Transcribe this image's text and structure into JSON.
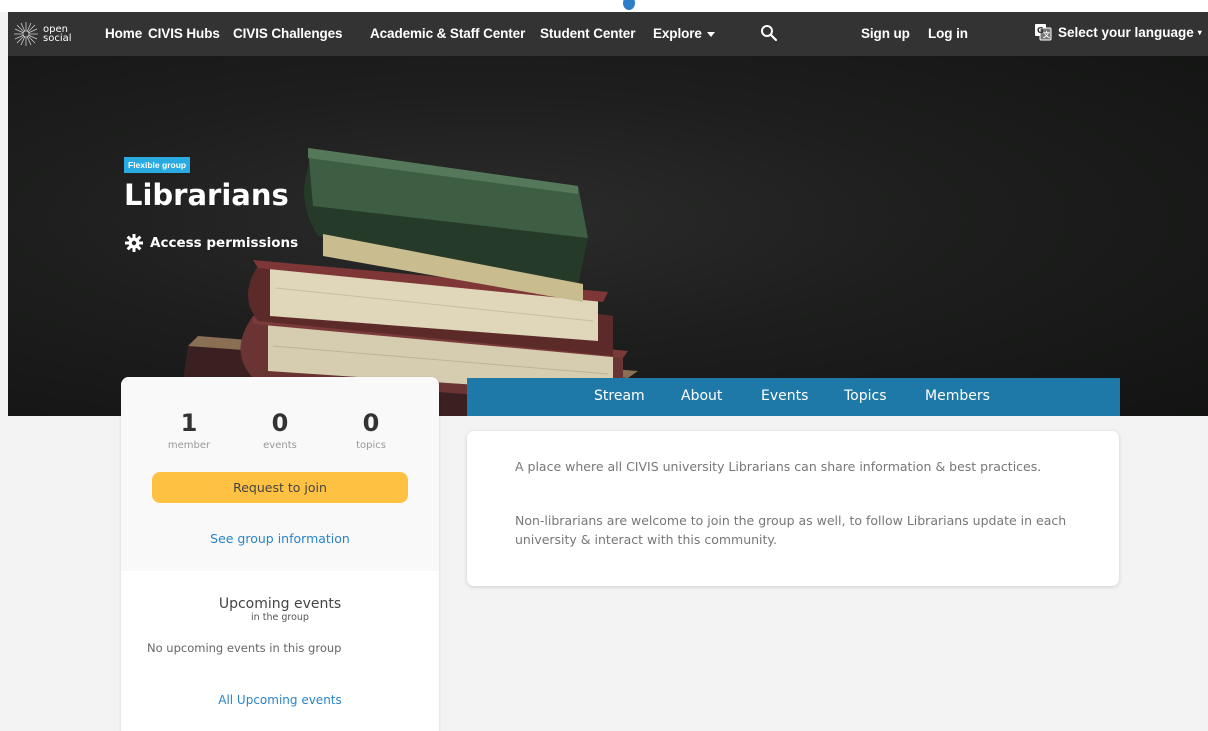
{
  "nav": {
    "logo_line1": "open",
    "logo_line2": "social",
    "items": [
      "Home",
      "CIVIS Hubs",
      "CIVIS Challenges",
      "Academic & Staff Center",
      "Student Center",
      "Explore"
    ],
    "sign_up": "Sign up",
    "log_in": "Log in",
    "language": "Select your language"
  },
  "hero": {
    "badge": "Flexible group",
    "title": "Librarians",
    "access": "Access permissions"
  },
  "stats": [
    {
      "num": "1",
      "label": "member"
    },
    {
      "num": "0",
      "label": "events"
    },
    {
      "num": "0",
      "label": "topics"
    }
  ],
  "sidebar": {
    "join": "Request to join",
    "see_info": "See group information",
    "upcoming_title": "Upcoming events",
    "upcoming_sub": "in the group",
    "no_events": "No upcoming events in this group",
    "all_events": "All Upcoming events"
  },
  "tabs": [
    "Stream",
    "About",
    "Events",
    "Topics",
    "Members"
  ],
  "about": {
    "p1": "A place where all CIVIS university Librarians can share information & best practices.",
    "p2": "Non-librarians are welcome to join the group as well, to follow Librarians update in each university & interact with this community."
  },
  "colors": {
    "navbar": "#333333",
    "badge": "#29abe2",
    "join_button": "#ffc142",
    "tabs": "#1f79a8",
    "link": "#2a84c7"
  }
}
